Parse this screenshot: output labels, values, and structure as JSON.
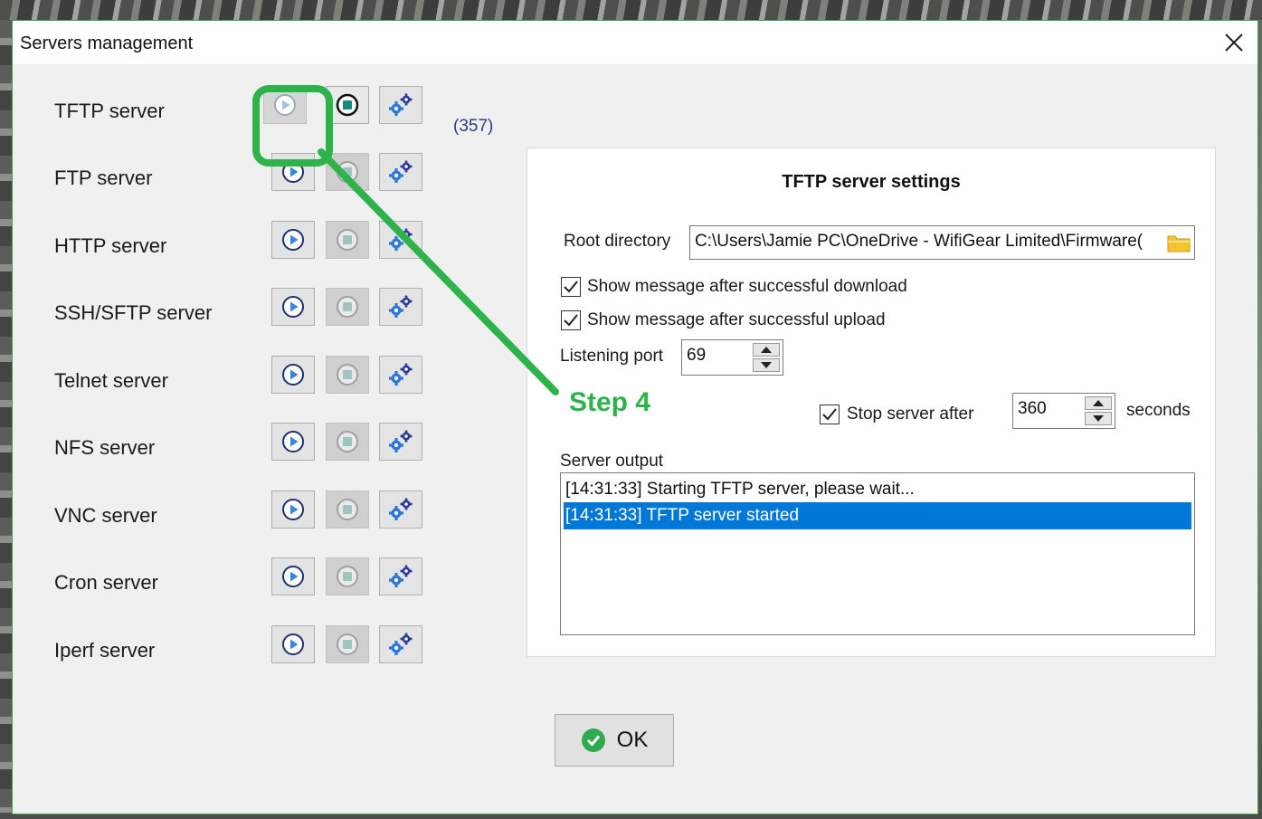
{
  "window": {
    "title": "Servers management",
    "accent": "#2fa84f"
  },
  "servers": [
    {
      "label": "TFTP server",
      "running": true
    },
    {
      "label": "FTP server",
      "running": false
    },
    {
      "label": "HTTP server",
      "running": false
    },
    {
      "label": "SSH/SFTP server",
      "running": false
    },
    {
      "label": "Telnet server",
      "running": false
    },
    {
      "label": "NFS server",
      "running": false
    },
    {
      "label": "VNC server",
      "running": false
    },
    {
      "label": "Cron server",
      "running": false
    },
    {
      "label": "Iperf server",
      "running": false
    }
  ],
  "tftp_count": "(357)",
  "settings": {
    "title": "TFTP server settings",
    "root_label": "Root directory",
    "root_value": "C:\\Users\\Jamie PC\\OneDrive - WifiGear Limited\\Firmware(",
    "show_download_label": "Show message after successful download",
    "show_download_checked": true,
    "show_upload_label": "Show message after successful upload",
    "show_upload_checked": true,
    "port_label": "Listening port",
    "port_value": "69",
    "stop_after_label": "Stop server after",
    "stop_after_checked": true,
    "stop_after_value": "360",
    "seconds_label": "seconds",
    "output_label": "Server output",
    "output_lines": [
      "[14:31:33] Starting TFTP server, please wait...",
      "[14:31:33] TFTP server started"
    ],
    "selected_line": 1
  },
  "ok_label": "OK",
  "annotation": {
    "text": "Step 4",
    "color": "#2db34a"
  },
  "icons": {
    "play": "play-circle-icon",
    "stop": "stop-square-icon",
    "gear": "gears-icon",
    "close": "close-icon",
    "folder": "folder-icon",
    "ok": "check-circle-icon"
  }
}
